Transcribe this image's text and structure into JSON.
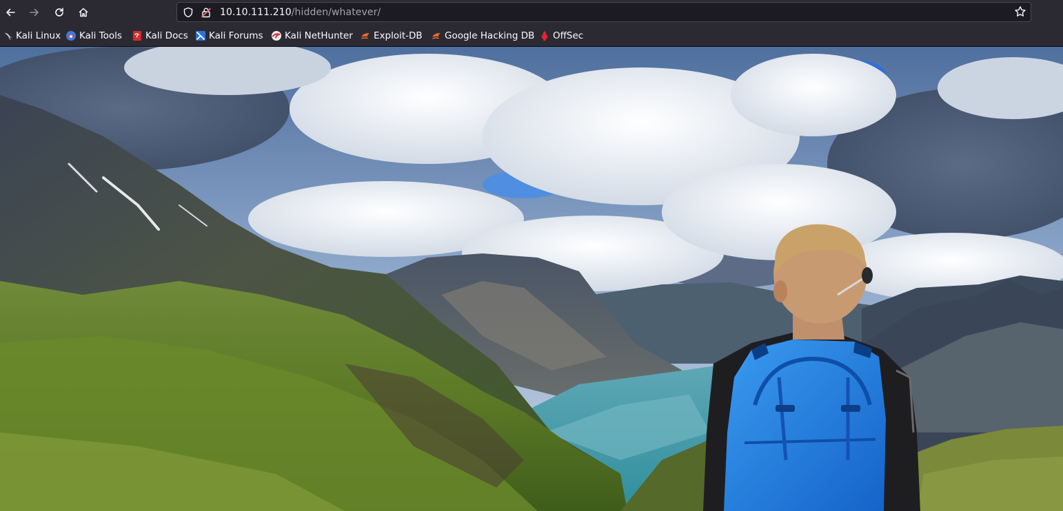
{
  "browser": {
    "nav": {
      "back": "back-icon",
      "forward": "forward-icon",
      "reload": "reload-icon",
      "home": "home-icon"
    },
    "url": {
      "host": "10.10.111.210",
      "path": "/hidden/whatever/"
    },
    "bookmarks": [
      {
        "label": "Kali Linux",
        "icon": "kali-dragon-icon"
      },
      {
        "label": "Kali Tools",
        "icon": "kali-tools-icon"
      },
      {
        "label": "Kali Docs",
        "icon": "kali-docs-icon"
      },
      {
        "label": "Kali Forums",
        "icon": "kali-forums-icon"
      },
      {
        "label": "Kali NetHunter",
        "icon": "kali-nethunter-icon"
      },
      {
        "label": "Exploit-DB",
        "icon": "exploit-db-icon"
      },
      {
        "label": "Google Hacking DB",
        "icon": "google-hacking-db-icon"
      },
      {
        "label": "OffSec",
        "icon": "offsec-icon"
      }
    ]
  },
  "page": {
    "image": "hiker-mountain-fjord-photo"
  },
  "colors": {
    "toolbar": "#2b2a33",
    "urlbar": "#1c1b22",
    "text": "#fbfbfe",
    "muted_text": "#a3a2ac",
    "backpack": "#1f7fe0"
  }
}
